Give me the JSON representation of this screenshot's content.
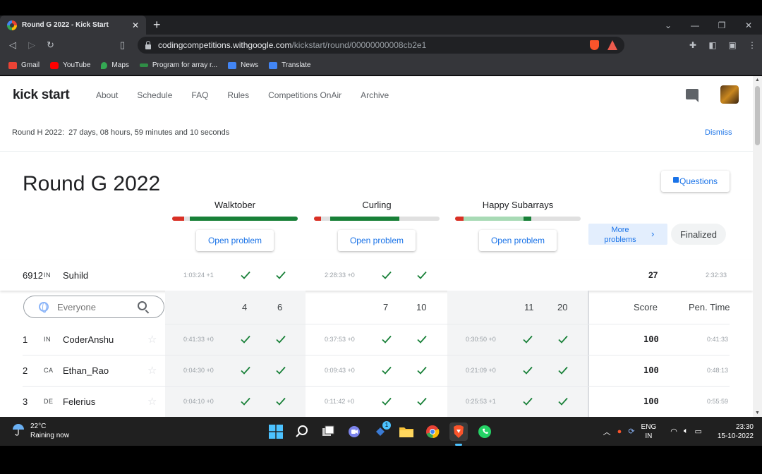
{
  "browser": {
    "tab_title": "Round G 2022 - Kick Start",
    "url_host": "codingcompetitions.withgoogle.com",
    "url_path": "/kickstart/round/00000000008cb2e1",
    "bookmarks": [
      "Gmail",
      "YouTube",
      "Maps",
      "Program for array r...",
      "News",
      "Translate"
    ]
  },
  "header": {
    "logo": "kick start",
    "nav": [
      "About",
      "Schedule",
      "FAQ",
      "Rules",
      "Competitions OnAir",
      "Archive"
    ]
  },
  "banner": {
    "prefix": "Round H 2022:",
    "countdown": "27 days, 08 hours, 59 minutes and 10 seconds",
    "dismiss": "Dismiss"
  },
  "round": {
    "title": "Round G 2022",
    "questions_label": "Questions",
    "more_problems": "More problems",
    "status": "Finalized"
  },
  "problems": [
    {
      "name": "Walktober",
      "open_label": "Open problem"
    },
    {
      "name": "Curling",
      "open_label": "Open problem"
    },
    {
      "name": "Happy Subarrays",
      "open_label": "Open problem"
    }
  ],
  "me": {
    "rank": "6912",
    "country": "IN",
    "name": "Suhild",
    "times": [
      "1:03:24 +1",
      "2:28:33 +0",
      ""
    ],
    "score": "27",
    "penalty": "2:32:33"
  },
  "table": {
    "search_placeholder": "Everyone",
    "max_points": [
      [
        "4",
        "6"
      ],
      [
        "7",
        "10"
      ],
      [
        "11",
        "20"
      ]
    ],
    "score_header": "Score",
    "penalty_header": "Pen. Time",
    "rows": [
      {
        "rank": "1",
        "country": "IN",
        "name": "CoderAnshu",
        "times": [
          "0:41:33 +0",
          "0:37:53 +0",
          "0:30:50 +0"
        ],
        "score": "100",
        "penalty": "0:41:33"
      },
      {
        "rank": "2",
        "country": "CA",
        "name": "Ethan_Rao",
        "times": [
          "0:04:30 +0",
          "0:09:43 +0",
          "0:21:09 +0"
        ],
        "score": "100",
        "penalty": "0:48:13"
      },
      {
        "rank": "3",
        "country": "DE",
        "name": "Felerius",
        "times": [
          "0:04:10 +0",
          "0:11:42 +0",
          "0:25:53 +1"
        ],
        "score": "100",
        "penalty": "0:55:59"
      }
    ]
  },
  "taskbar": {
    "temperature": "22°C",
    "weather": "Raining now",
    "lang_top": "ENG",
    "lang_bottom": "IN",
    "time": "23:30",
    "date": "15-10-2022",
    "badge": "1"
  },
  "colors": {
    "green": "#188038",
    "light_green": "#a8dab5",
    "red": "#d93025",
    "link_blue": "#1a73e8"
  },
  "icons": [
    "search-icon",
    "globe-icon",
    "star-icon",
    "chat-icon",
    "check-icon",
    "chevron-right-icon"
  ]
}
